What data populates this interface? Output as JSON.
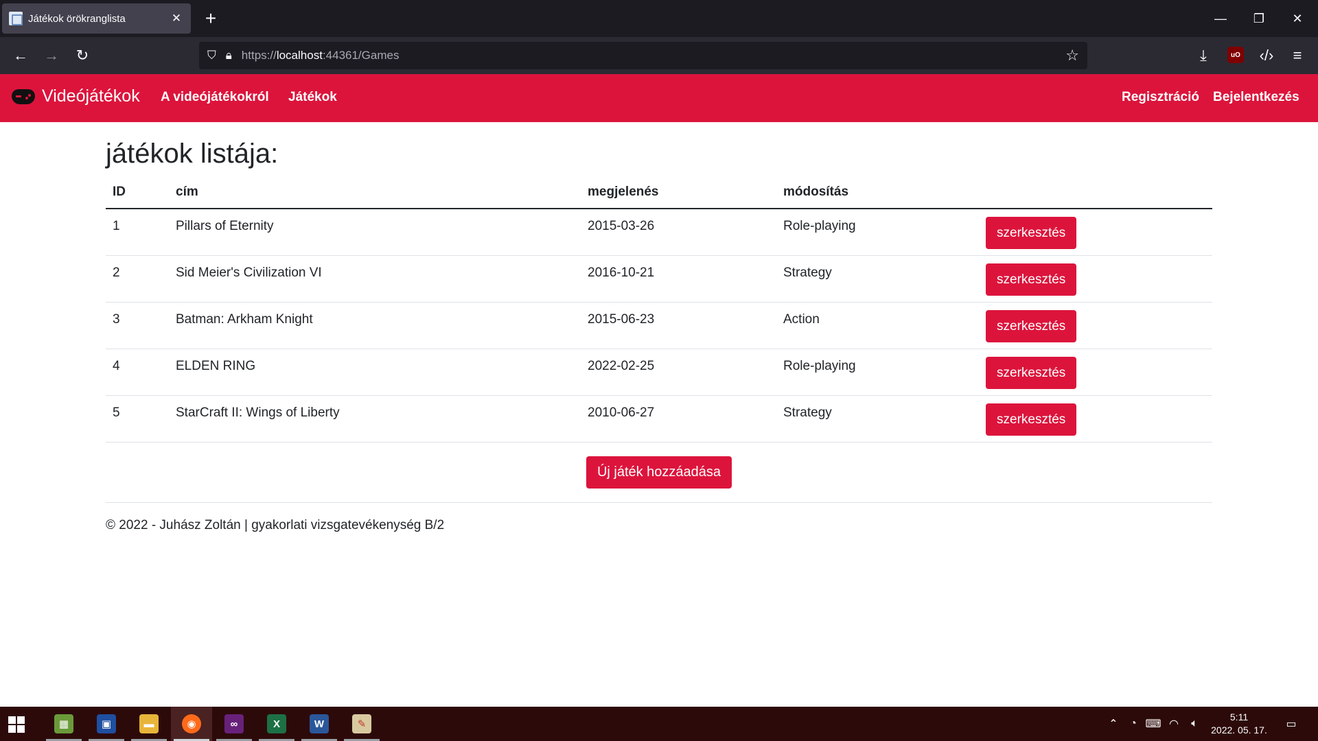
{
  "browser": {
    "tab_title": "Játékok örökranglista",
    "url_scheme": "https://",
    "url_host": "localhost",
    "url_rest": ":44361/Games"
  },
  "site": {
    "brand": "Videójátékok",
    "nav": [
      "A videójátékokról",
      "Játékok"
    ],
    "nav_right": [
      "Regisztráció",
      "Bejelentkezés"
    ],
    "accent_color": "#dc143c"
  },
  "main": {
    "heading": "játékok listája:",
    "columns": [
      "ID",
      "cím",
      "megjelenés",
      "módosítás"
    ],
    "rows": [
      {
        "id": "1",
        "title": "Pillars of Eternity",
        "release": "2015-03-26",
        "genre": "Role-playing"
      },
      {
        "id": "2",
        "title": "Sid Meier's Civilization VI",
        "release": "2016-10-21",
        "genre": "Strategy"
      },
      {
        "id": "3",
        "title": "Batman: Arkham Knight",
        "release": "2015-06-23",
        "genre": "Action"
      },
      {
        "id": "4",
        "title": "ELDEN RING",
        "release": "2022-02-25",
        "genre": "Role-playing"
      },
      {
        "id": "5",
        "title": "StarCraft II: Wings of Liberty",
        "release": "2010-06-27",
        "genre": "Strategy"
      }
    ],
    "edit_label": "szerkesztés",
    "add_label": "Új játék hozzáadása"
  },
  "footer": {
    "text": "© 2022 - Juhász Zoltán | gyakorlati vizsgatevékenység B/2"
  },
  "taskbar": {
    "apps": [
      "minecraft-icon",
      "save-disk-icon",
      "file-explorer-icon",
      "firefox-icon",
      "visual-studio-icon",
      "excel-icon",
      "word-icon",
      "paint-icon"
    ],
    "time": "5:11",
    "date": "2022. 05. 17."
  }
}
